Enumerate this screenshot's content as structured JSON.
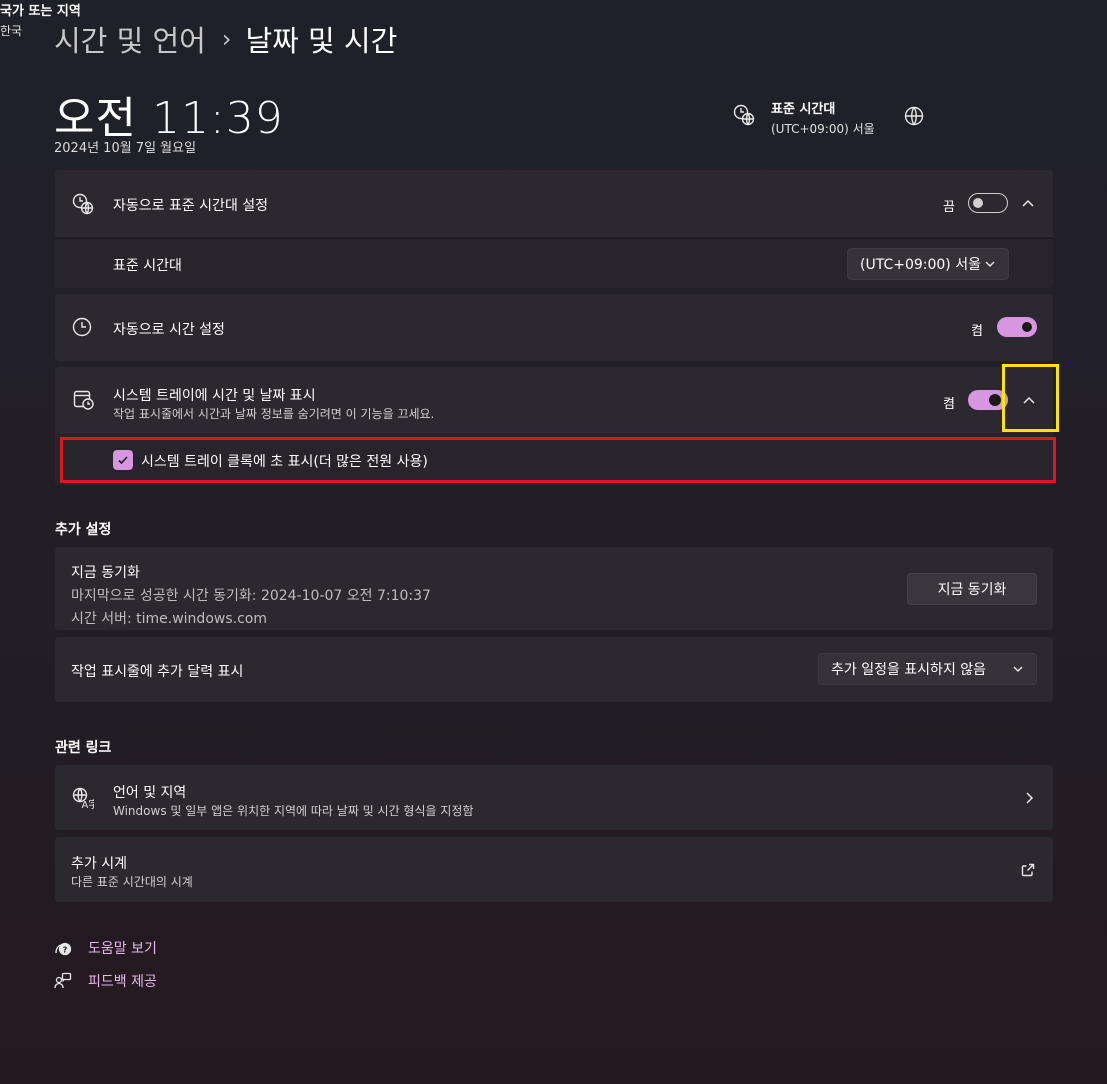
{
  "breadcrumb": {
    "parent": "시간 및 언어",
    "separator": "›",
    "current": "날짜 및 시간"
  },
  "clock": {
    "time": "오전 11:39",
    "date": "2024년 10월 7일 월요일"
  },
  "header_info": {
    "timezone": {
      "title": "표준 시간대",
      "value": "(UTC+09:00) 서울",
      "icon": "timezone-globe-icon"
    },
    "region": {
      "title": "국가 또는 지역",
      "value": "한국",
      "icon": "globe-icon"
    }
  },
  "auto_timezone": {
    "label": "자동으로 표준 시간대 설정",
    "state": "끔",
    "on": false,
    "timezone_label": "표준 시간대",
    "timezone_value": "(UTC+09:00) 서울"
  },
  "auto_time": {
    "label": "자동으로 시간 설정",
    "state": "켬",
    "on": true
  },
  "tray": {
    "label": "시스템 트레이에 시간 및 날짜 표시",
    "description": "작업 표시줄에서 시간과 날짜 정보를 숨기려면 이 기능을 끄세요.",
    "state": "켬",
    "on": true,
    "seconds_label": "시스템 트레이 클록에 초 표시(더 많은 전원 사용)",
    "seconds_checked": true
  },
  "additional": {
    "section_title": "추가 설정",
    "sync": {
      "title": "지금 동기화",
      "last_sync": "마지막으로 성공한 시간 동기화: 2024-10-07 오전 7:10:37",
      "server": "시간 서버: time.windows.com",
      "button": "지금 동기화"
    },
    "calendar": {
      "label": "작업 표시줄에 추가 달력 표시",
      "value": "추가 일정을 표시하지 않음"
    }
  },
  "related": {
    "section_title": "관련 링크",
    "language": {
      "title": "언어 및 지역",
      "description": "Windows 및 일부 앱은 위치한 지역에 따라 날짜 및 시간 형식을 지정함"
    },
    "clocks": {
      "title": "추가 시계",
      "description": "다른 표준 시간대의 시계"
    }
  },
  "footer": {
    "help": "도움말 보기",
    "feedback": "피드백 제공"
  },
  "colors": {
    "accent": "#d697e0",
    "highlight_yellow": "#ffe600",
    "highlight_red": "#e0161e"
  }
}
